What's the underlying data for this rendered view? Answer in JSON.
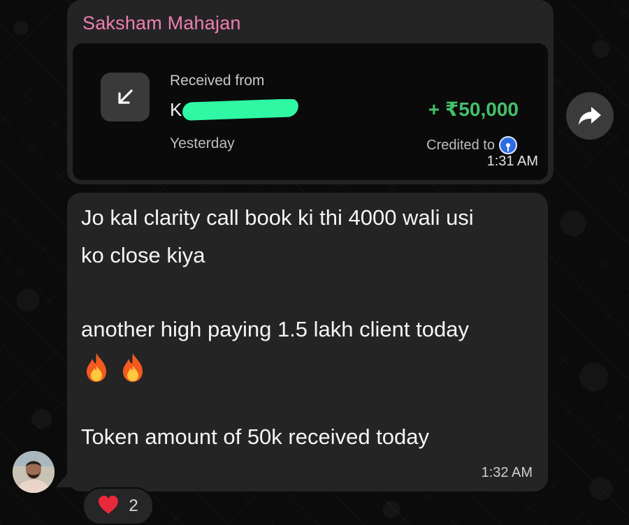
{
  "chat": {
    "sender_name": "Saksham Mahajan"
  },
  "payment": {
    "label": "Received from",
    "name_visible": "K                     ARAO KA...",
    "amount": "+ ₹50,000",
    "date": "Yesterday",
    "credited_label": "Credited to",
    "icon": "arrow-down-left-icon",
    "bank_icon": "bank-logo-icon"
  },
  "messages": [
    {
      "lines": [
        "Jo kal clarity call book ki thi 4000 wali usi",
        "ko close kiya",
        "another high paying 1.5 lakh client today",
        "Token amount of 50k received today"
      ],
      "emoji": [
        "🔥",
        "🔥"
      ],
      "time": "1:32 AM"
    }
  ],
  "payment_time": "1:31 AM",
  "reaction": {
    "emoji": "❤️",
    "count": "2"
  },
  "colors": {
    "sender_name": "#ef7fb0",
    "amount": "#45c06a",
    "bubble": "#242424",
    "background": "#0b0b0b"
  }
}
